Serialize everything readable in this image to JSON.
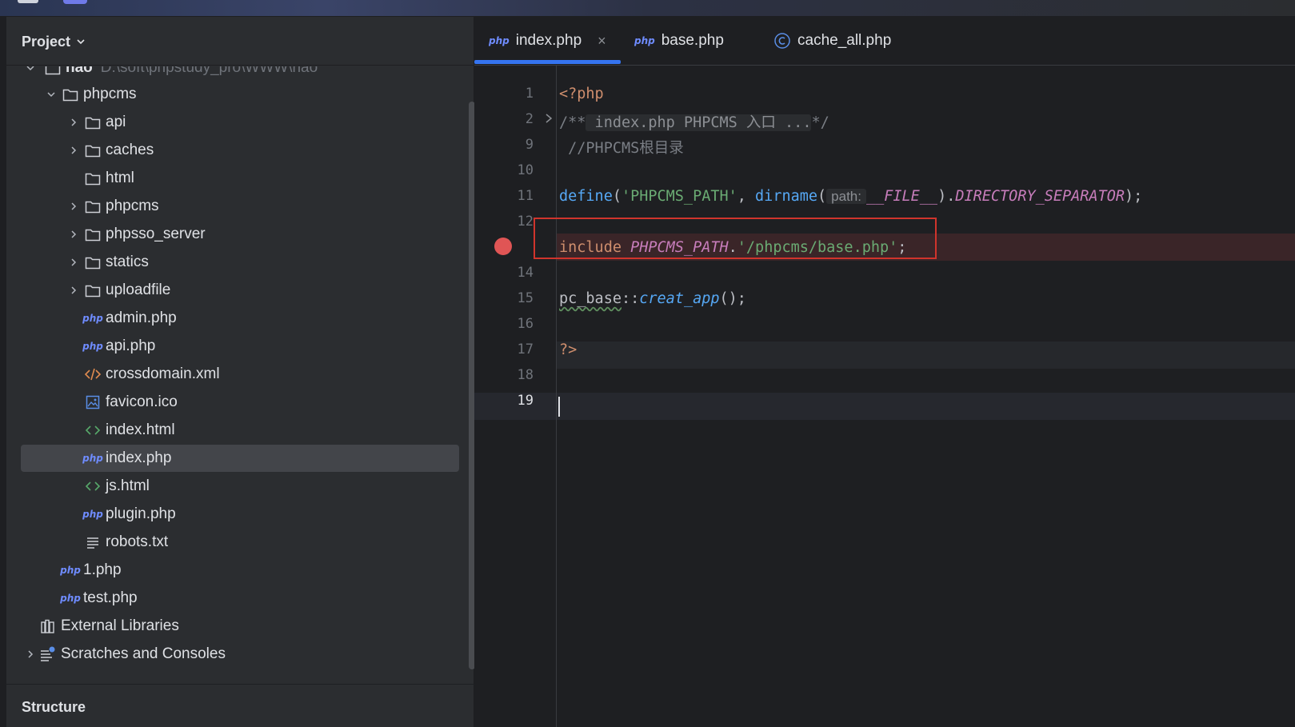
{
  "project_panel": {
    "title": "Project",
    "root": {
      "name": "nao",
      "path": "D:\\soft\\phpstudy_pro\\WWW\\nao"
    },
    "items": [
      {
        "label": "phpcms",
        "kind": "folder",
        "expanded": true
      },
      {
        "label": "api",
        "kind": "folder"
      },
      {
        "label": "caches",
        "kind": "folder"
      },
      {
        "label": "html",
        "kind": "folder"
      },
      {
        "label": "phpcms",
        "kind": "folder"
      },
      {
        "label": "phpsso_server",
        "kind": "folder"
      },
      {
        "label": "statics",
        "kind": "folder"
      },
      {
        "label": "uploadfile",
        "kind": "folder"
      },
      {
        "label": "admin.php",
        "kind": "php"
      },
      {
        "label": "api.php",
        "kind": "php"
      },
      {
        "label": "crossdomain.xml",
        "kind": "xml"
      },
      {
        "label": "favicon.ico",
        "kind": "image"
      },
      {
        "label": "index.html",
        "kind": "html"
      },
      {
        "label": "index.php",
        "kind": "php",
        "selected": true
      },
      {
        "label": "js.html",
        "kind": "html"
      },
      {
        "label": "plugin.php",
        "kind": "php"
      },
      {
        "label": "robots.txt",
        "kind": "text"
      },
      {
        "label": "1.php",
        "kind": "php"
      },
      {
        "label": "test.php",
        "kind": "php"
      },
      {
        "label": "External Libraries",
        "kind": "libraries"
      },
      {
        "label": "Scratches and Consoles",
        "kind": "scratches"
      }
    ],
    "php_badge": "php"
  },
  "structure_panel": {
    "title": "Structure"
  },
  "tabs": [
    {
      "label": "index.php",
      "badge": "php",
      "active": true,
      "close": "×"
    },
    {
      "label": "base.php",
      "badge": "php"
    },
    {
      "label": "cache_all.php",
      "badge": "C"
    }
  ],
  "editor": {
    "line_numbers": [
      "1",
      "2",
      "9",
      "10",
      "11",
      "12",
      "14",
      "15",
      "16",
      "17",
      "18",
      "19"
    ],
    "lines": {
      "l1": "<?php",
      "l2_open": "/**",
      "l2_folded": " index.php PHPCMS 入口 ...",
      "l2_close": "*/",
      "l9": " //PHPCMS根目录",
      "l11_define": "define",
      "l11_p1": "(",
      "l11_str": "'PHPCMS_PATH'",
      "l11_comma": ", ",
      "l11_dirname": "dirname",
      "l11_p2": "(",
      "l11_hint": "path:",
      "l11_file": "__FILE__",
      "l11_dot": ").",
      "l11_sep": "DIRECTORY_SEPARATOR",
      "l11_end": ");",
      "l13_include": "include",
      "l13_const": "PHPCMS_PATH",
      "l13_dot": ".",
      "l13_str": "'/phpcms/base.php'",
      "l13_end": ";",
      "l15_class": "pc_base",
      "l15_sep": "::",
      "l15_method": "creat_app",
      "l15_end": "();",
      "l17": "?>"
    }
  },
  "colors": {
    "keyword": "#cf8e6d",
    "string": "#6aab73",
    "function": "#56a8f5",
    "constant": "#c77dbb",
    "comment": "#7a7e85",
    "breakpoint": "#e05555",
    "highlight_box": "#d0342c",
    "accent": "#3574f0"
  }
}
